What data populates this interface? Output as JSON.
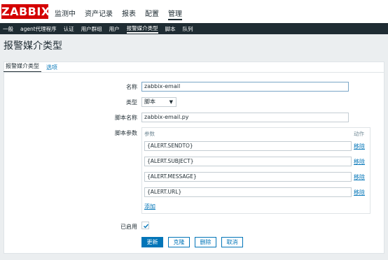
{
  "header": {
    "logo": "ZABBIX",
    "menu": [
      "监测中",
      "资产记录",
      "报表",
      "配置",
      "管理"
    ],
    "active_menu": 4
  },
  "subnav": {
    "items": [
      "一般",
      "agent代理程序",
      "认证",
      "用户群组",
      "用户",
      "报警媒介类型",
      "脚本",
      "队列"
    ],
    "active": 5
  },
  "page_title": "报警媒介类型",
  "tabs": [
    "报警媒介类型",
    "选项"
  ],
  "form": {
    "name_label": "名称",
    "name_value": "zabbix-email",
    "type_label": "类型",
    "type_value": "脚本",
    "script_name_label": "脚本名称",
    "script_name_value": "zabbix-email.py",
    "script_params_label": "脚本参数",
    "params_header": "参数",
    "action_header": "动作",
    "params": [
      "{ALERT.SENDTO}",
      "{ALERT.SUBJECT}",
      "{ALERT.MESSAGE}",
      "{ALERT.URL}"
    ],
    "remove_label": "移除",
    "add_label": "添加",
    "enabled_label": "已启用",
    "enabled": true
  },
  "buttons": {
    "update": "更新",
    "clone": "克隆",
    "delete": "删除",
    "cancel": "取消"
  },
  "colors": {
    "brand": "#d40000",
    "nav": "#1f2c33",
    "link": "#0275b8"
  }
}
